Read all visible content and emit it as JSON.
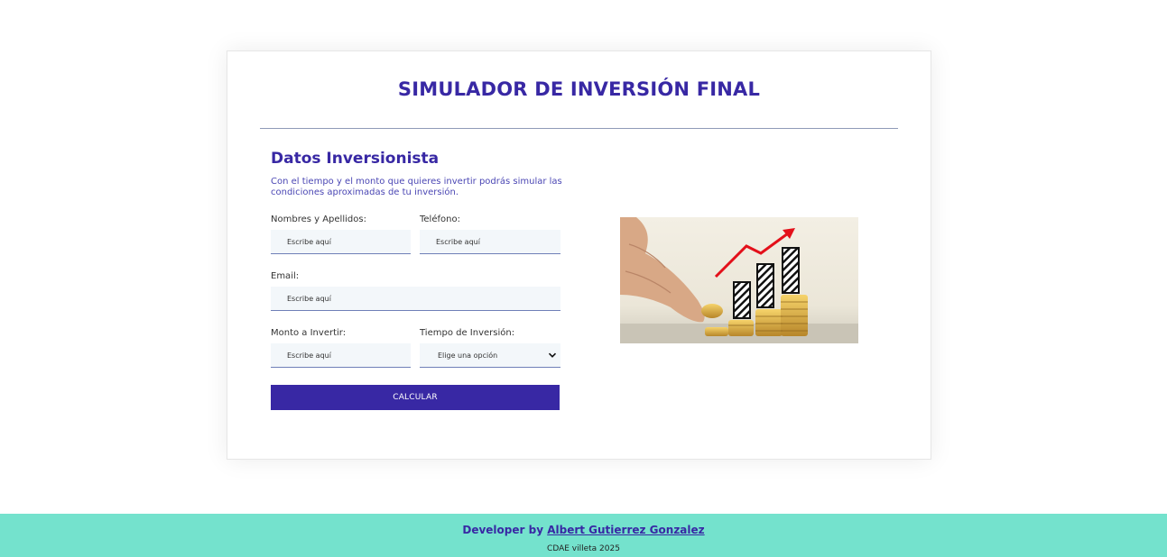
{
  "header": {
    "title": "SIMULADOR DE INVERSIÓN FINAL"
  },
  "form": {
    "section_title": "Datos Inversionista",
    "section_description": "Con el tiempo y el monto que quieres invertir podrás simular las condiciones aproximadas de tu inversión.",
    "fields": {
      "name": {
        "label": "Nombres y Apellidos:",
        "placeholder": "Escribe aquí",
        "value": ""
      },
      "phone": {
        "label": "Teléfono:",
        "placeholder": "Escribe aquí",
        "value": ""
      },
      "email": {
        "label": "Email:",
        "placeholder": "Escribe aquí",
        "value": ""
      },
      "amount": {
        "label": "Monto a Invertir:",
        "placeholder": "Escribe aquí",
        "value": ""
      },
      "time": {
        "label": "Tiempo de Inversión:",
        "selected": "Elige una opción"
      }
    },
    "submit_label": "CALCULAR"
  },
  "footer": {
    "developer_prefix": "Developer by",
    "developer_name": "Albert Gutierrez Gonzalez",
    "org_line": "CDAE villeta 2025"
  },
  "colors": {
    "accent": "#3828a4",
    "footer_bg": "#74e2cd",
    "input_bg": "#f3f7fa"
  },
  "icons": {
    "select_chevron": "chevron-down-icon",
    "illustration": "investment-growth-image"
  }
}
